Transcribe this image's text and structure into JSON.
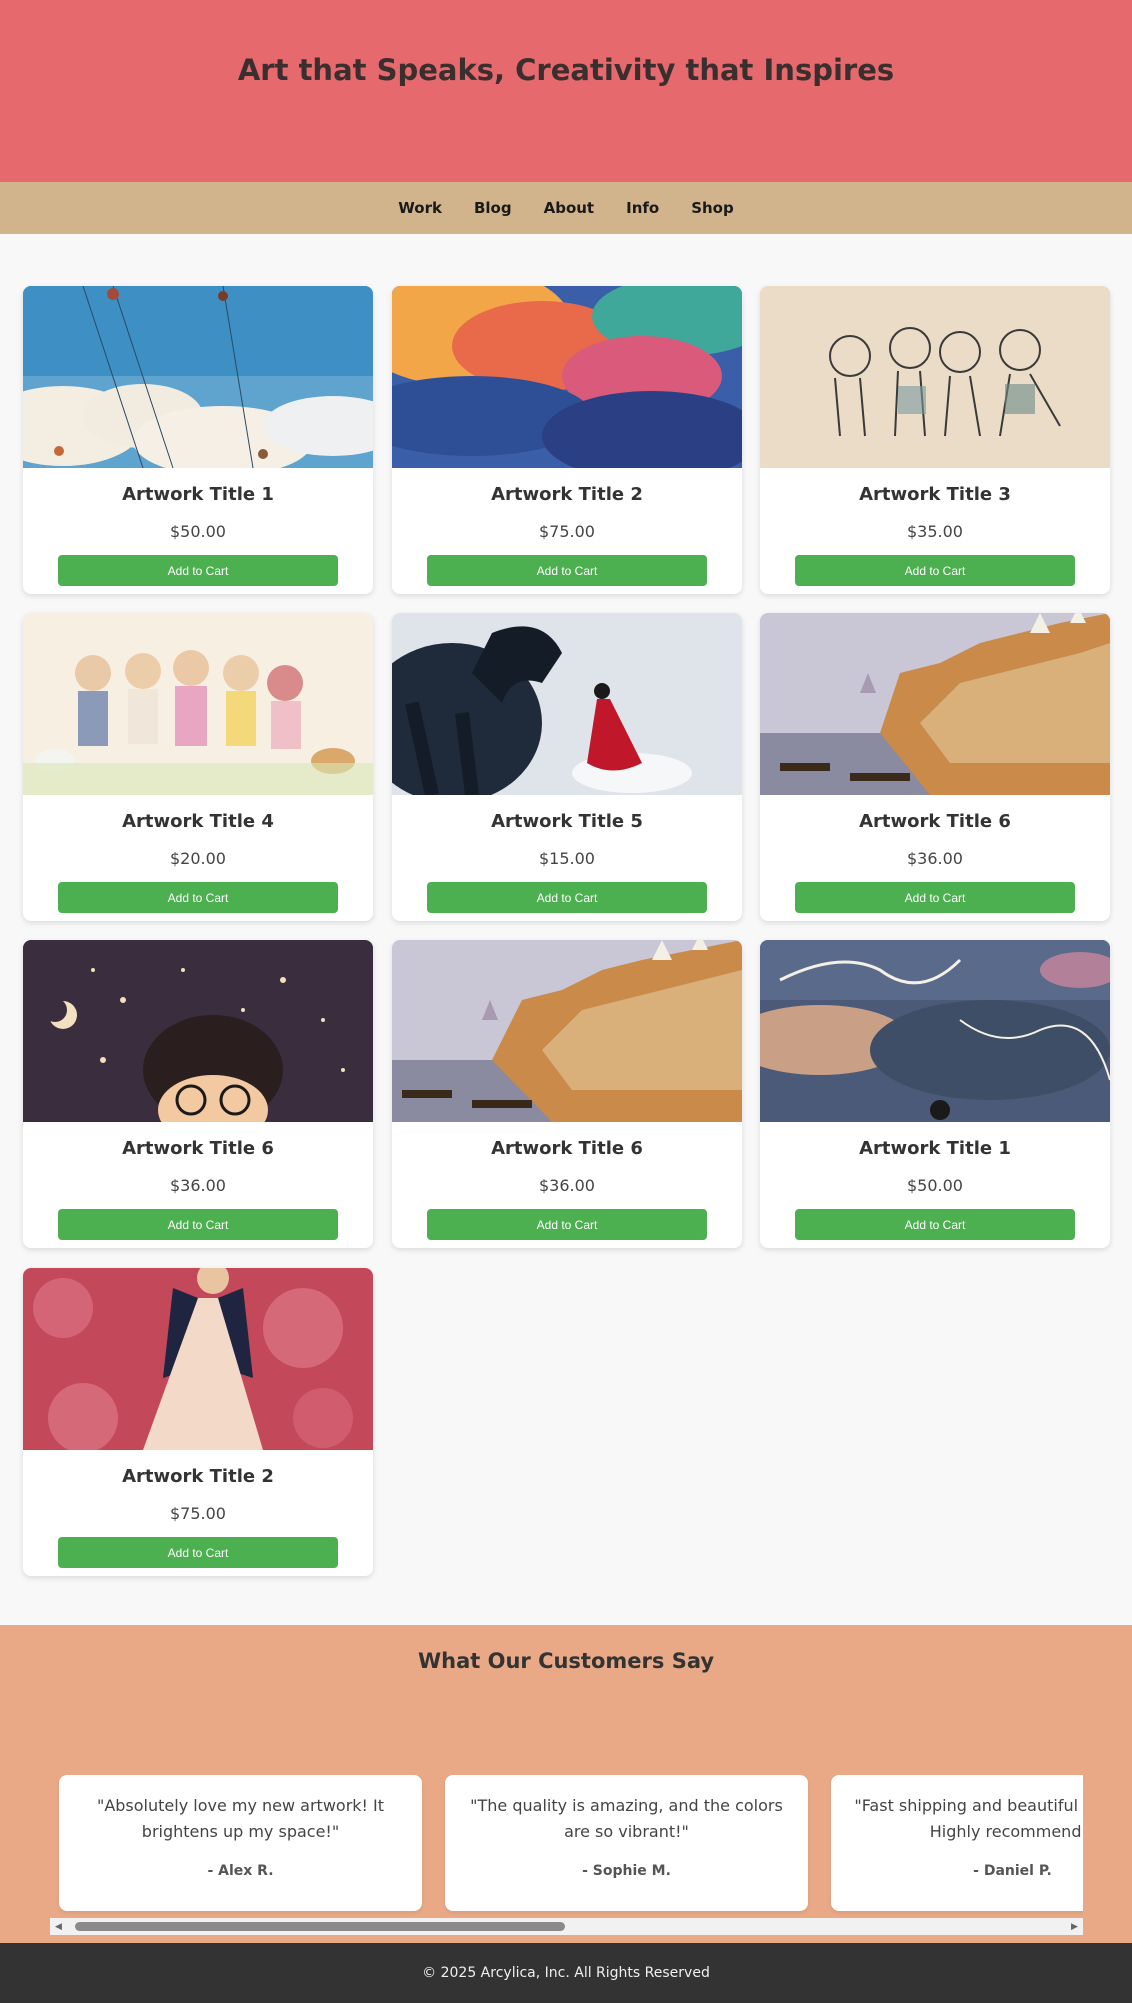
{
  "hero": {
    "title": "Art that Speaks, Creativity that Inspires"
  },
  "nav": {
    "items": [
      "Work",
      "Blog",
      "About",
      "Info",
      "Shop"
    ]
  },
  "products": [
    {
      "title": "Artwork Title 1",
      "price": "$50.00",
      "button": "Add to Cart"
    },
    {
      "title": "Artwork Title 2",
      "price": "$75.00",
      "button": "Add to Cart"
    },
    {
      "title": "Artwork Title 3",
      "price": "$35.00",
      "button": "Add to Cart"
    },
    {
      "title": "Artwork Title 4",
      "price": "$20.00",
      "button": "Add to Cart"
    },
    {
      "title": "Artwork Title 5",
      "price": "$15.00",
      "button": "Add to Cart"
    },
    {
      "title": "Artwork Title 6",
      "price": "$36.00",
      "button": "Add to Cart"
    },
    {
      "title": "Artwork Title 6",
      "price": "$36.00",
      "button": "Add to Cart"
    },
    {
      "title": "Artwork Title 6",
      "price": "$36.00",
      "button": "Add to Cart"
    },
    {
      "title": "Artwork Title 1",
      "price": "$50.00",
      "button": "Add to Cart"
    },
    {
      "title": "Artwork Title 2",
      "price": "$75.00",
      "button": "Add to Cart"
    }
  ],
  "reviews": {
    "title": "What Our Customers Say",
    "items": [
      {
        "text": "\"Absolutely love my new artwork! It brightens up my space!\"",
        "author": "- Alex R."
      },
      {
        "text": "\"The quality is amazing, and the colors are so vibrant!\"",
        "author": "- Sophie M."
      },
      {
        "text": "\"Fast shipping and beautiful packaging. Highly recommend!\"",
        "author": "- Daniel P."
      }
    ]
  },
  "footer": {
    "text": "© 2025 Arcylica, Inc. All Rights Reserved"
  },
  "colors": {
    "hero": "#e5696d",
    "nav": "#d2b48c",
    "button": "#4caf50",
    "reviews": "#e9a987",
    "footer": "#333333"
  }
}
